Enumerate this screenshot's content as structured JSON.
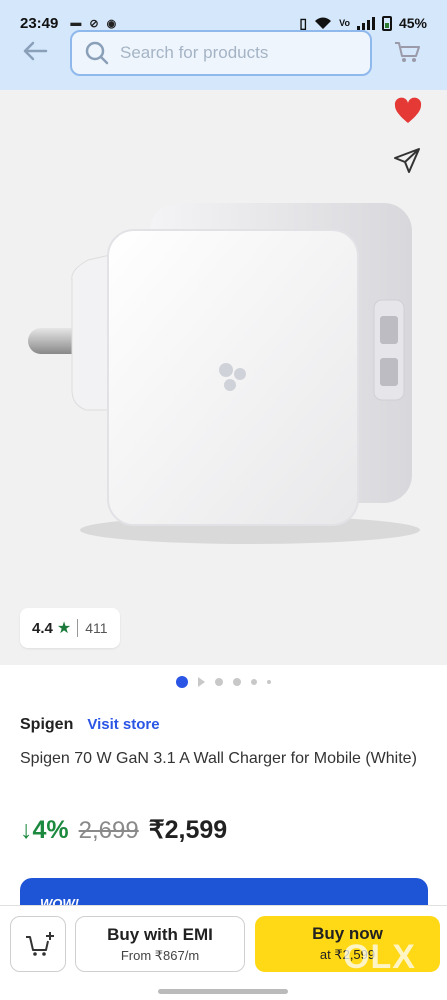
{
  "status_bar": {
    "time": "23:49",
    "battery": "45%",
    "battery_level": 0.45,
    "icons": [
      "notification-icon",
      "link-icon",
      "whatsapp-icon",
      "vibrate-icon",
      "wifi-icon",
      "volte-icon",
      "signal-icon",
      "battery-icon"
    ]
  },
  "header": {
    "search_placeholder": "Search for products",
    "icons": [
      "back-arrow-icon",
      "search-icon",
      "cart-icon"
    ]
  },
  "gallery": {
    "rating": "4.4",
    "rating_count": "411",
    "image_count": 6,
    "active_image": 1,
    "icons": [
      "heart-icon",
      "share-icon",
      "star-icon"
    ]
  },
  "product": {
    "brand": "Spigen",
    "visit_store": "Visit store",
    "title": "Spigen 70 W GaN 3.1 A Wall Charger for Mobile (White)",
    "discount": "↓4%",
    "mrp": "2,699",
    "price": "₹2,599"
  },
  "promo": {
    "text": "WOW!"
  },
  "bottom_bar": {
    "emi_label": "Buy with EMI",
    "emi_sub": "From ₹867/m",
    "buy_label": "Buy now",
    "buy_sub": "at ₹2,599",
    "watermark": "OLX",
    "icons": [
      "add-to-cart-icon"
    ]
  },
  "colors": {
    "header_bg": "#d5e7fb",
    "accent_blue": "#2a55e5",
    "discount_green": "#1b8a3e",
    "buy_yellow": "#ffd816",
    "heart_red": "#e53935"
  }
}
